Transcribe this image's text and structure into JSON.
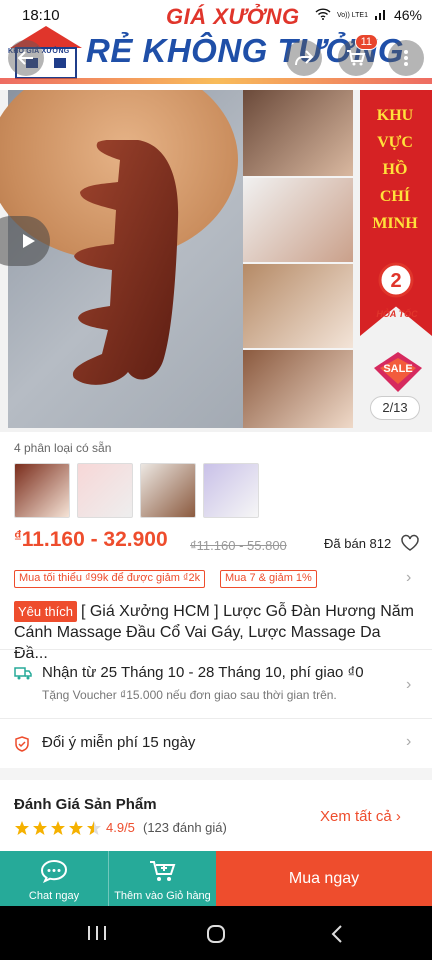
{
  "status_bar": {
    "time": "18:10",
    "battery": "46%",
    "network": "Vo)) LTE1"
  },
  "banner": {
    "brand": "KHO GIÁ XƯỞNG",
    "line1": "GIÁ XƯỞNG",
    "line2": "RẺ KHÔNG TƯỞNG"
  },
  "cart_count": "11",
  "gallery": {
    "region_tag": [
      "KHU",
      "VỰC",
      "HỒ",
      "CHÍ",
      "MINH"
    ],
    "fast_delivery": "HỎA TỐC",
    "fast_hours": "2",
    "counter": "2/13",
    "sale_tag": "SALE"
  },
  "variants": {
    "label": "4 phân loại có sẵn"
  },
  "price": {
    "currency": "₫",
    "range": "11.160 - 32.900",
    "old": "₫11.160 - 55.800",
    "sold": "Đã bán 812"
  },
  "promos": [
    "Mua tối thiểu ₫99k để được giảm ₫2k",
    "Mua 7 & giảm 1%"
  ],
  "product": {
    "badge": "Yêu thích",
    "title": "[ Giá Xưởng HCM ] Lược Gỗ Đàn Hương Năm Cánh Massage Đầu Cổ Vai Gáy, Lược Massage Da Đầ..."
  },
  "shipping": {
    "line": "Nhận từ 25 Tháng 10 - 28 Tháng 10, phí giao ₫0",
    "sub": "Tặng Voucher ₫15.000 nếu đơn giao sau thời gian trên."
  },
  "returns": {
    "line": "Đổi ý miễn phí 15 ngày"
  },
  "reviews": {
    "title": "Đánh Giá Sản Phẩm",
    "rating": 4.9,
    "score": "4.9/5",
    "count": "(123 đánh giá)",
    "see_all": "Xem tất cả"
  },
  "bottom_bar": {
    "chat": "Chat ngay",
    "add_cart": "Thêm vào Giỏ hàng",
    "buy": "Mua ngay"
  },
  "colors": {
    "accent": "#ee4d2d",
    "teal": "#26aa99"
  }
}
